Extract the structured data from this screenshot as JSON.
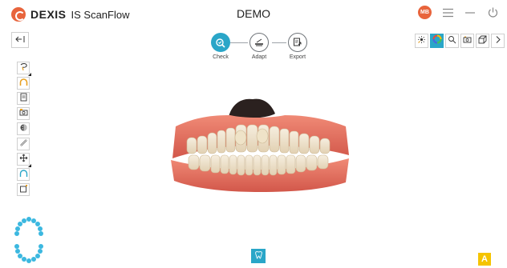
{
  "app": {
    "brand_name": "DEXIS",
    "product_name": "IS ScanFlow",
    "document_title": "DEMO",
    "user_initials": "MB"
  },
  "title_controls": [
    {
      "icon": "user-avatar"
    },
    {
      "icon": "hamburger-menu-icon"
    },
    {
      "icon": "minimize-icon"
    },
    {
      "icon": "power-icon"
    }
  ],
  "workflow": {
    "steps": [
      {
        "label": "Check",
        "icon": "check-scan-icon",
        "active": true
      },
      {
        "label": "Adapt",
        "icon": "adapt-trim-icon",
        "active": false
      },
      {
        "label": "Export",
        "icon": "export-icon",
        "active": false
      }
    ]
  },
  "left_tools": [
    {
      "icon": "lasso-cut-icon",
      "has_submenu": true
    },
    {
      "icon": "upper-arch-icon",
      "has_submenu": false
    },
    {
      "icon": "document-icon",
      "has_submenu": false
    },
    {
      "icon": "camera-photo-icon",
      "has_submenu": false
    },
    {
      "icon": "color-texture-icon",
      "has_submenu": false
    },
    {
      "icon": "measure-ruler-icon",
      "has_submenu": false
    },
    {
      "icon": "move-pan-icon",
      "has_submenu": true
    },
    {
      "icon": "arch-outline-icon",
      "has_submenu": false
    },
    {
      "icon": "partial-tool-icon",
      "has_submenu": false
    }
  ],
  "view_toolbar": [
    {
      "icon": "lighting-icon",
      "active": false
    },
    {
      "icon": "color-wheel-icon",
      "active": true
    },
    {
      "icon": "zoom-icon",
      "active": false
    },
    {
      "icon": "snapshot-icon",
      "active": false
    },
    {
      "icon": "view-cube-icon",
      "active": false
    },
    {
      "icon": "chevron-right-icon",
      "active": false
    }
  ],
  "corner_badge": "A",
  "colors": {
    "accent": "#2aa6c8",
    "brand": "#e8643c",
    "badge": "#f5c400",
    "gingiva": "#e06b5c",
    "tooth": "#f1e6d2"
  }
}
